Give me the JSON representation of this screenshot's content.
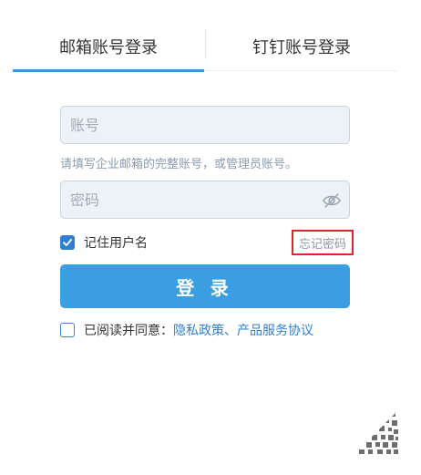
{
  "tabs": {
    "mail_login": "邮箱账号登录",
    "dingtalk_login": "钉钉账号登录"
  },
  "account": {
    "placeholder": "账号",
    "hint": "请填写企业邮箱的完整账号，或管理员账号。"
  },
  "password": {
    "placeholder": "密码",
    "visibility_icon": "eye-off-icon"
  },
  "remember": {
    "label": "记住用户名",
    "checked": true
  },
  "forgot_password": "忘记密码",
  "login_button": "登 录",
  "agreement": {
    "checked": false,
    "prefix": "已阅读并同意：",
    "privacy_link": "隐私政策",
    "separator": "、",
    "service_link": "产品服务协议"
  },
  "qr_icon": "qr-code-icon",
  "colors": {
    "accent": "#3a9ee0",
    "link": "#2f7fd1",
    "highlight_border": "#d9272e"
  }
}
